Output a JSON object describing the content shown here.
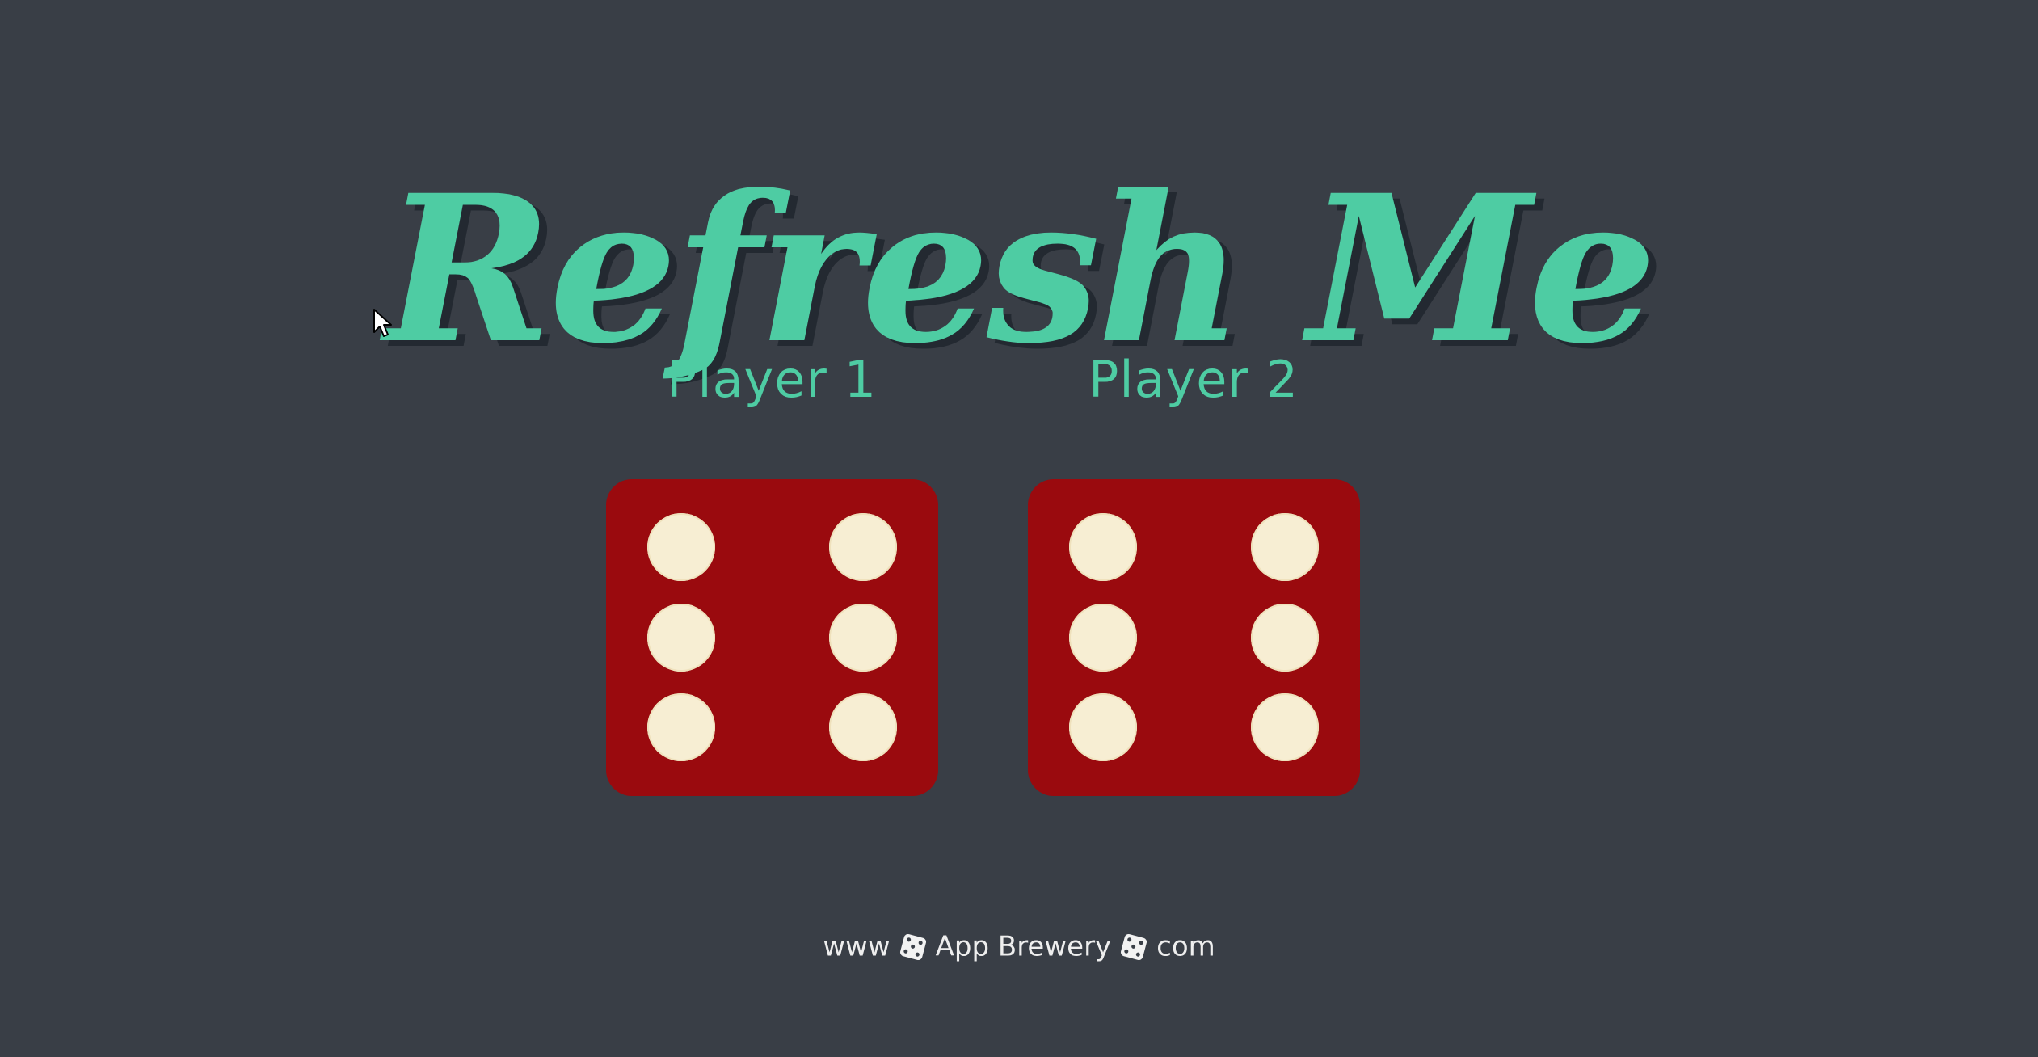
{
  "title": "Refresh Me",
  "players": [
    {
      "label": "Player 1",
      "die_value": 6
    },
    {
      "label": "Player 2",
      "die_value": 6
    }
  ],
  "footer": {
    "part1": "www",
    "part2": "App Brewery",
    "part3": "com",
    "separator_icon": "dice-icon"
  },
  "colors": {
    "background": "#393e46",
    "accent": "#4ecca3",
    "die_face": "#9a0a0e",
    "pip": "#f7eed3"
  }
}
